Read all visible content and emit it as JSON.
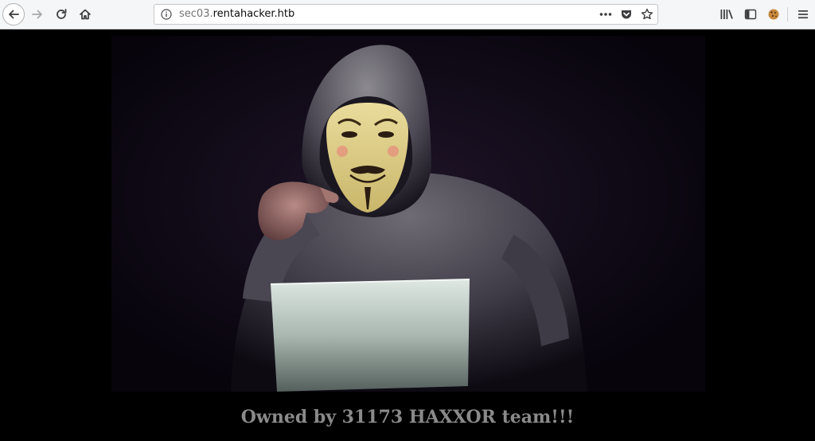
{
  "browser": {
    "url_subdomain": "sec03.",
    "url_domain": "rentahacker.htb",
    "buttons": {
      "back": "back-arrow-icon",
      "forward": "forward-arrow-icon",
      "reload": "reload-icon",
      "home": "home-icon",
      "page_actions": "ellipsis-icon",
      "pocket": "pocket-icon",
      "bookmark": "star-icon",
      "library": "library-icon",
      "sidebar": "sidebar-icon",
      "extension": "cookie-icon",
      "menu": "hamburger-icon"
    }
  },
  "page": {
    "hero_image": "hooded-hacker-guy-fawkes-mask-laptop",
    "headline": "Owned by 31173 HAXXOR team!!!"
  },
  "colors": {
    "page_background": "#000000",
    "headline": "#8a8a8a",
    "toolbar": "#f5f6f7"
  }
}
